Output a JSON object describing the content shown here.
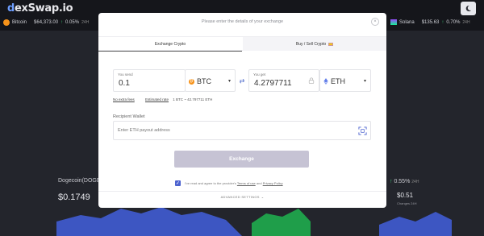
{
  "app": {
    "logo_prefix": "d",
    "logo_main": "exSwap.io"
  },
  "tickers": [
    {
      "name": "Bitcoin",
      "price": "$64,373.00",
      "change": "0.05%",
      "period": "24H",
      "color": "#f7931a"
    },
    {
      "name": "Solana",
      "price": "$135.63",
      "change": "0.70%",
      "period": "24H",
      "color": "#9945ff"
    }
  ],
  "background": {
    "doge_name": "Dogecoin(DOGE)",
    "doge_price": "$0.1749",
    "right_change": "0.55%",
    "right_period": "24H",
    "right_price": "$0.51",
    "right_label": "Changes 24H"
  },
  "modal": {
    "title": "Please enter the details of your exchange",
    "close_glyph": "×",
    "tabs": [
      {
        "label": "Exchange Crypto",
        "active": true
      },
      {
        "label": "Buy / Sell Crypto",
        "active": false
      }
    ],
    "send": {
      "label": "You send",
      "value": "0.1",
      "coin": "BTC",
      "coin_color": "#f7931a"
    },
    "get": {
      "label": "You get",
      "value": "4.2797711",
      "coin": "ETH",
      "coin_color": "#627eea"
    },
    "no_fees": "No extra fees",
    "estimated_label": "Estimated rate",
    "estimated_value": "1 BTC ~ 42.797711 ETH",
    "wallet_label": "Recipient Wallet",
    "wallet_placeholder": "Enter ETH payout address",
    "exchange_button": "Exchange",
    "agree": {
      "prefix": "I've read and agree to the provider's",
      "terms": "Terms of use",
      "and": "and",
      "privacy": "Privacy Policy"
    },
    "advanced": "ADVANCED SETTINGS",
    "advanced_glyph": "⌄"
  }
}
